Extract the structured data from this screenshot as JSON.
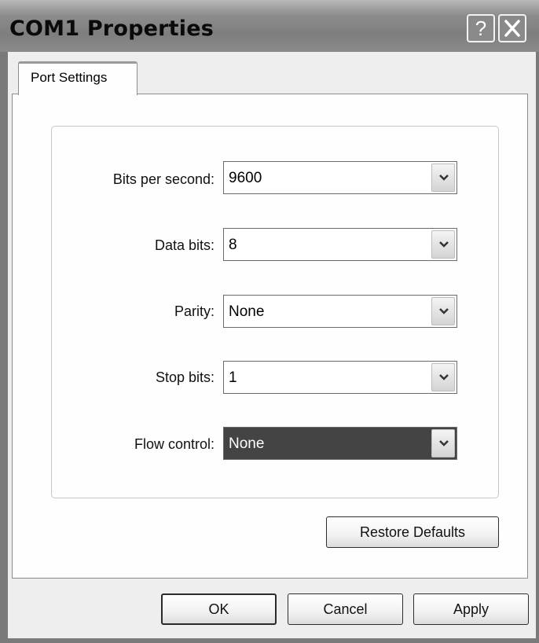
{
  "window": {
    "title": "COM1 Properties",
    "help_glyph": "?",
    "close_glyph": "X"
  },
  "tabs": [
    {
      "label": "Port Settings",
      "active": true
    }
  ],
  "fields": [
    {
      "label": "Bits per second:",
      "value": "9600"
    },
    {
      "label": "Data bits:",
      "value": "8"
    },
    {
      "label": "Parity:",
      "value": "None"
    },
    {
      "label": "Stop bits:",
      "value": "1"
    },
    {
      "label": "Flow control:",
      "value": "None",
      "focused": true
    }
  ],
  "buttons": {
    "restore_defaults": "Restore Defaults",
    "ok": "OK",
    "cancel": "Cancel",
    "apply": "Apply"
  },
  "icons": {
    "help": "help-icon",
    "close": "close-icon",
    "dropdown": "chevron-down-icon"
  }
}
